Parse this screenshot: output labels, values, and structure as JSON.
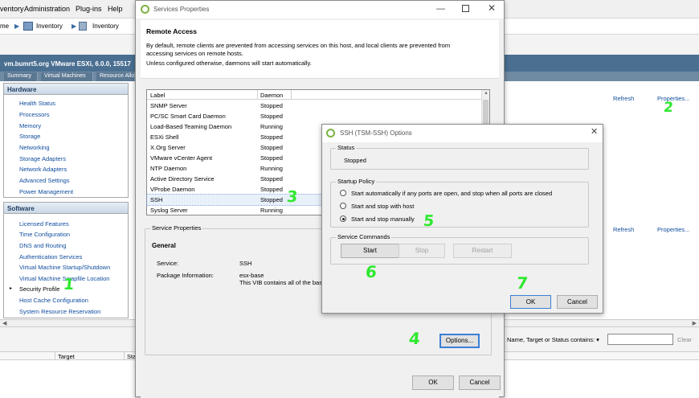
{
  "menubar": {
    "items": [
      "ventory",
      "Administration",
      "Plug-ins",
      "Help"
    ]
  },
  "navbar": {
    "home": "me",
    "crumb1": "Inventory",
    "crumb2": "Inventory"
  },
  "host": {
    "title": "vm.bumrt5.org VMware ESXi, 6.0.0, 15517",
    "tabs": [
      "Summary",
      "Virtual Machines",
      "Resource Allo"
    ]
  },
  "sidebar": {
    "hardware_title": "Hardware",
    "hardware_items": [
      "Health Status",
      "Processors",
      "Memory",
      "Storage",
      "Networking",
      "Storage Adapters",
      "Network Adapters",
      "Advanced Settings",
      "Power Management"
    ],
    "software_title": "Software",
    "software_items": [
      "Licensed Features",
      "Time Configuration",
      "DNS and Routing",
      "Authentication Services",
      "Virtual Machine Startup/Shutdown",
      "Virtual Machine Swapfile Location",
      "Security Profile",
      "Host Cache Configuration",
      "System Resource Reservation"
    ]
  },
  "right": {
    "refresh1": "Refresh",
    "properties1": "Properties...",
    "refresh2": "Refresh",
    "properties2": "Properties...",
    "filter_label": "Name, Target or Status contains: ▾",
    "clear": "Clear"
  },
  "bottom": {
    "col_target": "Target",
    "col_status": "Sta"
  },
  "services_dialog": {
    "title": "Services Properties",
    "section": "Remote Access",
    "desc1": "By default, remote clients are prevented from accessing services on this host, and local clients are prevented from",
    "desc2": "accessing services on remote hosts.",
    "desc3": "Unless configured otherwise, daemons will start automatically.",
    "col_label": "Label",
    "col_daemon": "Daemon",
    "rows": [
      {
        "label": "SNMP Server",
        "daemon": "Stopped"
      },
      {
        "label": "PC/SC Smart Card Daemon",
        "daemon": "Stopped"
      },
      {
        "label": "Load-Based Teaming Daemon",
        "daemon": "Running"
      },
      {
        "label": "ESXi Shell",
        "daemon": "Stopped"
      },
      {
        "label": "X.Org Server",
        "daemon": "Stopped"
      },
      {
        "label": "VMware vCenter Agent",
        "daemon": "Stopped"
      },
      {
        "label": "NTP Daemon",
        "daemon": "Running"
      },
      {
        "label": "Active Directory Service",
        "daemon": "Stopped"
      },
      {
        "label": "VProbe Daemon",
        "daemon": "Stopped"
      },
      {
        "label": "SSH",
        "daemon": "Stopped"
      },
      {
        "label": "Syslog Server",
        "daemon": "Running"
      }
    ],
    "props_group": "Service Properties",
    "general": "General",
    "service_label": "Service:",
    "service_value": "SSH",
    "package_label": "Package Information:",
    "package_value1": "esx-base",
    "package_value2": "This VIB contains all of the bas",
    "options_button": "Options...",
    "ok": "OK",
    "cancel": "Cancel"
  },
  "ssh_dialog": {
    "title": "SSH (TSM-SSH) Options",
    "status_group": "Status",
    "status_value": "Stopped",
    "policy_group": "Startup Policy",
    "policy_options": [
      "Start automatically if any ports are open, and stop when all ports are closed",
      "Start and stop with host",
      "Start and stop manually"
    ],
    "selected_policy": 2,
    "commands_group": "Service Commands",
    "start": "Start",
    "stop": "Stop",
    "restart": "Restart",
    "ok": "OK",
    "cancel": "Cancel"
  },
  "annotations": [
    "1",
    "2",
    "3",
    "4",
    "5",
    "6",
    "7"
  ],
  "colors": {
    "link": "#0f4c9e",
    "host_bar": "#4a6f91",
    "annotation": "#2ee82e",
    "selection": "#e8f0fa"
  }
}
